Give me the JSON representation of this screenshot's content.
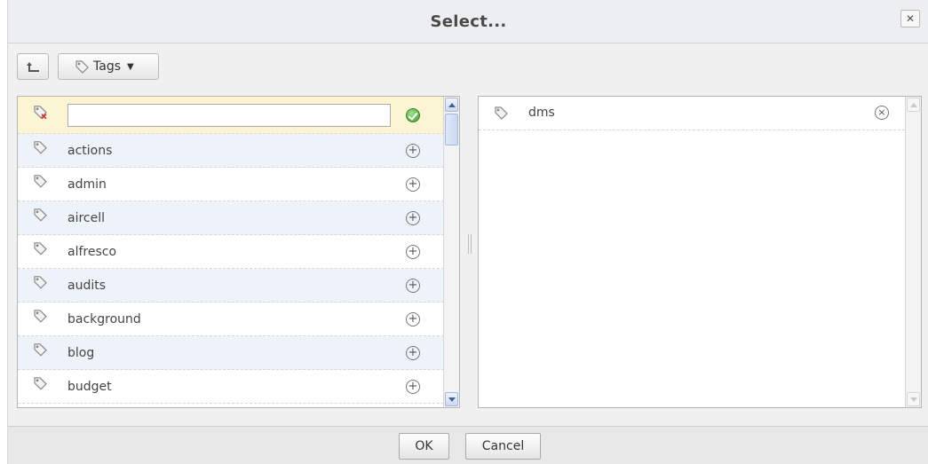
{
  "dialog": {
    "title": "Select...",
    "close_label": "✕"
  },
  "toolbar": {
    "tags_label": "Tags"
  },
  "picker": {
    "search": {
      "value": "",
      "placeholder": ""
    },
    "items": [
      {
        "label": "actions"
      },
      {
        "label": "admin"
      },
      {
        "label": "aircell"
      },
      {
        "label": "alfresco"
      },
      {
        "label": "audits"
      },
      {
        "label": "background"
      },
      {
        "label": "blog"
      },
      {
        "label": "budget"
      }
    ],
    "add_glyph": "+"
  },
  "selected": {
    "items": [
      {
        "label": "dms"
      }
    ],
    "remove_glyph": "×"
  },
  "footer": {
    "ok_label": "OK",
    "cancel_label": "Cancel"
  }
}
